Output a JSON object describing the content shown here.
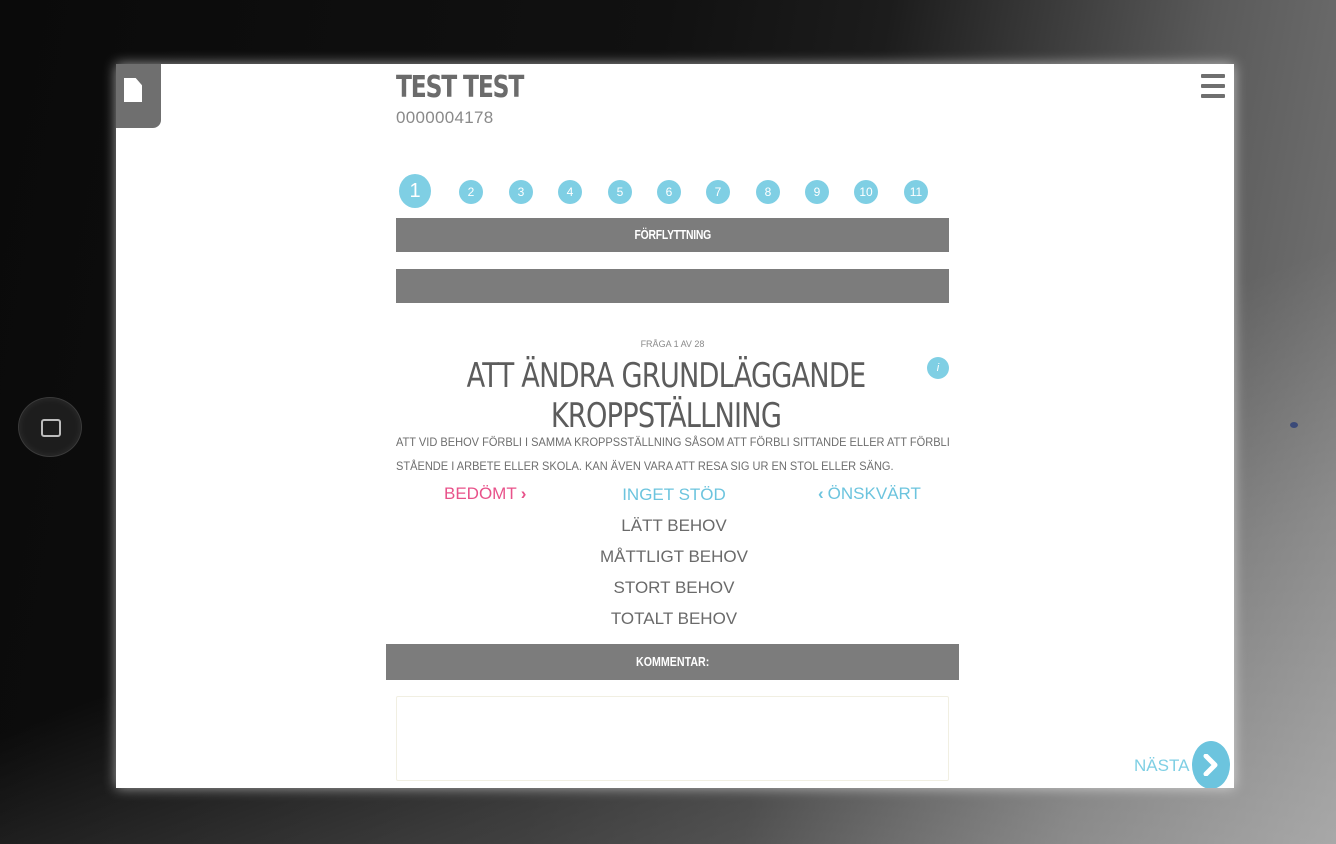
{
  "header": {
    "patient_name": "TEST TEST",
    "patient_id": "0000004178"
  },
  "steps": [
    "1",
    "2",
    "3",
    "4",
    "5",
    "6",
    "7",
    "8",
    "9",
    "10",
    "11"
  ],
  "active_step": 1,
  "section": {
    "title": "FÖRFLYTTNING",
    "subtitle": ""
  },
  "question": {
    "counter": "FRÅGA 1 AV 28",
    "title": "ATT ÄNDRA GRUNDLÄGGANDE KROPPSTÄLLNING",
    "description_line1": "ATT VID BEHOV FÖRBLI I SAMMA KROPPSSTÄLLNING SÅSOM ATT FÖRBLI SITTANDE ELLER ATT FÖRBLI",
    "description_line2": "STÅENDE I ARBETE ELLER SKOLA. KAN ÄVEN VARA ATT RESA SIG UR EN STOL ELLER SÄNG.",
    "info_label": "i"
  },
  "assessment": {
    "assessed_label": "BEDÖMT",
    "desired_label": "ÖNSKVÄRT",
    "options": [
      "INGET STÖD",
      "LÄTT BEHOV",
      "MÅTTLIGT BEHOV",
      "STORT BEHOV",
      "TOTALT BEHOV"
    ],
    "selected_option": "INGET STÖD"
  },
  "comment": {
    "label": "KOMMENTAR:",
    "value": ""
  },
  "navigation": {
    "next_label": "NÄSTA"
  },
  "colors": {
    "accent": "#7fcfe4",
    "assessed": "#e8528a",
    "bar": "#7c7c7c"
  },
  "icons": {
    "document": "document-icon",
    "menu": "hamburger-menu-icon",
    "info": "info-icon",
    "next": "chevron-right-icon"
  }
}
